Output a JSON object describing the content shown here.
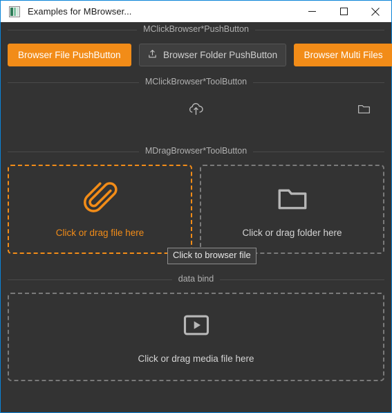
{
  "window": {
    "title": "Examples for MBrowser...",
    "app_icon": "app-window-icon",
    "controls": {
      "minimize": "minimize-button",
      "maximize": "maximize-button",
      "close": "close-button"
    },
    "border_color": "#0a84d8",
    "background_color": "#333333"
  },
  "theme": {
    "accent": "#f28c18",
    "panel_bg": "#333333",
    "button_bg": "#3f3f3f",
    "button_border": "#555555",
    "text": "#d0d0d0",
    "muted_text": "#b0b0b0",
    "dashed_idle": "#7a7a7a"
  },
  "sections": {
    "push_button": {
      "title": "MClickBrowser*PushButton",
      "buttons": [
        {
          "label": "Browser File PushButton",
          "style": "primary",
          "icon": null
        },
        {
          "label": "Browser Folder PushButton",
          "style": "normal",
          "icon": "upload-icon"
        },
        {
          "label": "Browser Multi Files",
          "style": "primary",
          "icon": null
        }
      ]
    },
    "tool_button": {
      "title": "MClickBrowser*ToolButton",
      "tools": [
        {
          "icon": "cloud-upload-icon",
          "position": "center"
        },
        {
          "icon": "folder-icon",
          "position": "right"
        }
      ]
    },
    "drag_browser": {
      "title": "MDragBrowser*ToolButton",
      "zones": [
        {
          "label": "Click or drag file here",
          "icon": "paperclip-icon",
          "state": "hover"
        },
        {
          "label": "Click or drag folder here",
          "icon": "folder-icon",
          "state": "idle"
        }
      ]
    },
    "data_bind": {
      "title": "data bind",
      "zone": {
        "label": "Click or drag media file here",
        "icon": "media-play-icon",
        "state": "idle"
      }
    }
  },
  "tooltip": {
    "text": "Click to browser file"
  }
}
